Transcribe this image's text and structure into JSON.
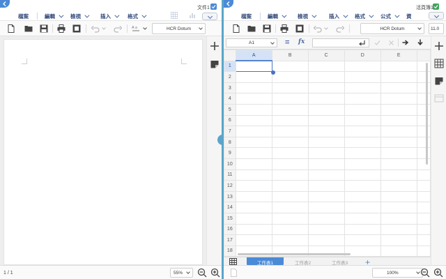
{
  "left": {
    "title": "文件1",
    "menu": [
      "檔案",
      "編輯",
      "檢視",
      "插入",
      "格式"
    ],
    "font": "HCR Dotum",
    "page_indicator": "1 / 1",
    "zoom": "55%"
  },
  "right": {
    "title": "活頁簿1",
    "menu": [
      "檔案",
      "編輯",
      "檢視",
      "插入",
      "格式",
      "公式",
      "資"
    ],
    "font": "HCR Dotum",
    "font_size": "11.0",
    "namebox": "A1",
    "formula_eq": "=",
    "fx": "fx",
    "columns": [
      "A",
      "B",
      "C",
      "D",
      "E"
    ],
    "rows": [
      "1",
      "2",
      "3",
      "4",
      "5",
      "6",
      "7",
      "8",
      "9",
      "10",
      "11",
      "12",
      "13",
      "14",
      "15",
      "16",
      "17",
      "18"
    ],
    "sheets": [
      "工作表1",
      "工作表2",
      "工作表3"
    ],
    "tab_add": "+",
    "zoom": "100%"
  },
  "colors": {
    "accent": "#4a8ad7",
    "divider": "#5aa5c9",
    "selection": "#4a72c4"
  },
  "icons": [
    "back-arrow-icon",
    "new-doc-icon",
    "open-folder-icon",
    "save-icon",
    "print-icon",
    "pdf-icon",
    "undo-icon",
    "redo-icon",
    "format-paint-icon",
    "plus-icon",
    "memo-icon",
    "zoom-out-icon",
    "zoom-in-icon",
    "arrow-right-icon",
    "arrow-down-icon",
    "sheet-grid-icon"
  ]
}
